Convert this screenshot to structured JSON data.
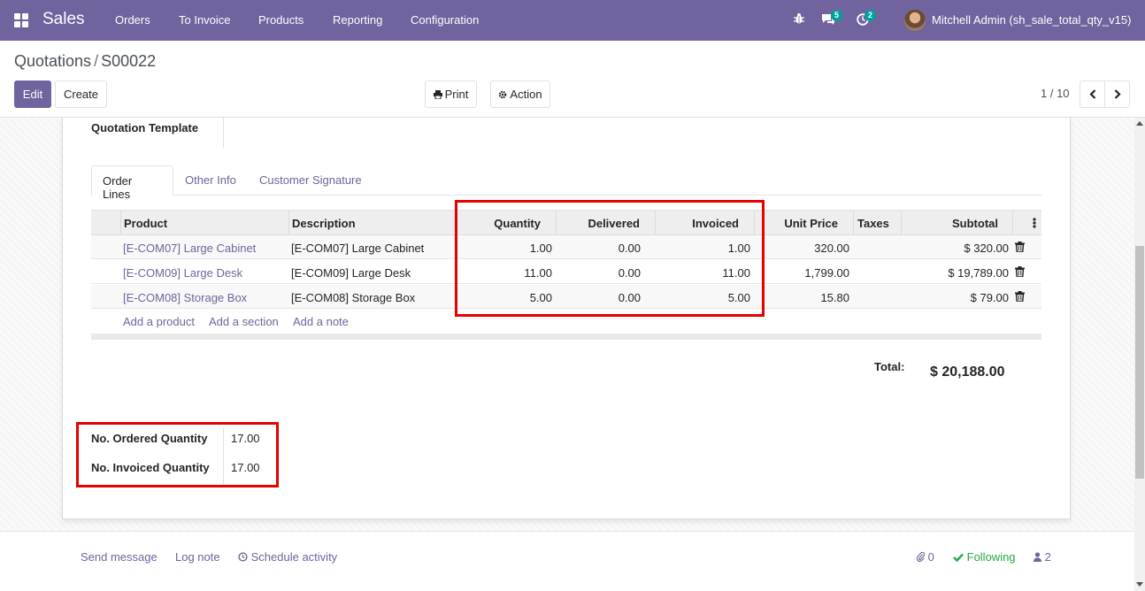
{
  "navbar": {
    "app_name": "Sales",
    "menu": [
      "Orders",
      "To Invoice",
      "Products",
      "Reporting",
      "Configuration"
    ],
    "messages_badge": "5",
    "activities_badge": "2",
    "user_name": "Mitchell Admin (sh_sale_total_qty_v15)",
    "bg_color": "#71639e"
  },
  "breadcrumb": {
    "parent": "Quotations",
    "separator": "/",
    "current": "S00022"
  },
  "toolbar": {
    "edit_label": "Edit",
    "create_label": "Create",
    "print_label": "Print",
    "action_label": "Action",
    "pager_value": "1 / 10"
  },
  "form": {
    "quotation_template_label": "Quotation Template",
    "tabs": [
      "Order Lines",
      "Other Info",
      "Customer Signature"
    ],
    "columns": [
      "Product",
      "Description",
      "Quantity",
      "Delivered",
      "Invoiced",
      "Unit Price",
      "Taxes",
      "Subtotal"
    ],
    "lines": [
      {
        "product": "[E-COM07] Large Cabinet",
        "description": "[E-COM07] Large Cabinet",
        "quantity": "1.00",
        "delivered": "0.00",
        "invoiced": "1.00",
        "unit_price": "320.00",
        "taxes": "",
        "subtotal": "$ 320.00"
      },
      {
        "product": "[E-COM09] Large Desk",
        "description": "[E-COM09] Large Desk",
        "quantity": "11.00",
        "delivered": "0.00",
        "invoiced": "11.00",
        "unit_price": "1,799.00",
        "taxes": "",
        "subtotal": "$ 19,789.00"
      },
      {
        "product": "[E-COM08] Storage Box",
        "description": "[E-COM08] Storage Box",
        "quantity": "5.00",
        "delivered": "0.00",
        "invoiced": "5.00",
        "unit_price": "15.80",
        "taxes": "",
        "subtotal": "$ 79.00"
      }
    ],
    "add_links": [
      "Add a product",
      "Add a section",
      "Add a note"
    ],
    "total_label": "Total:",
    "total_value": "$ 20,188.00",
    "ordered_qty_label": "No. Ordered Quantity",
    "ordered_qty_value": "17.00",
    "invoiced_qty_label": "No. Invoiced Quantity",
    "invoiced_qty_value": "17.00"
  },
  "chatter": {
    "send_message": "Send message",
    "log_note": "Log note",
    "schedule_activity": "Schedule activity",
    "attachments_count": "0",
    "following_label": "Following",
    "followers_count": "2"
  },
  "colors": {
    "accent": "#71639e",
    "highlight": "#e60000",
    "following": "#28a745"
  }
}
